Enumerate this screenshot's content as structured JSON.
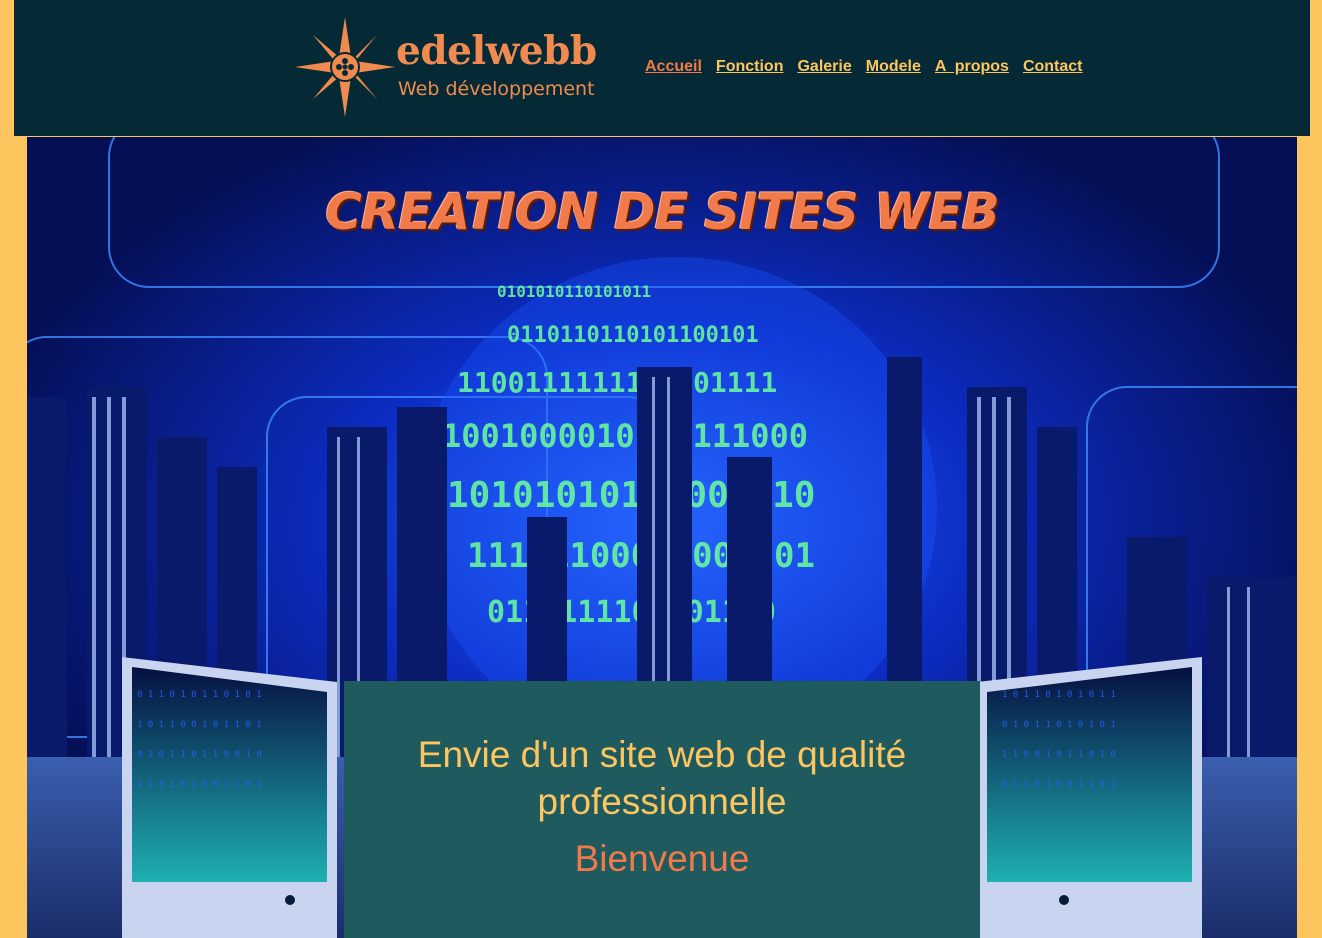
{
  "header": {
    "brand": "edelwebb",
    "tagline": "Web développement"
  },
  "nav": {
    "items": [
      {
        "label": "Accueil",
        "active": true
      },
      {
        "label": "Fonction",
        "active": false
      },
      {
        "label": "Galerie",
        "active": false
      },
      {
        "label": "Modele",
        "active": false
      },
      {
        "label": "A  propos",
        "active": false
      },
      {
        "label": "Contact",
        "active": false
      }
    ]
  },
  "hero": {
    "title": "CREATION DE SITES WEB"
  },
  "welcome": {
    "text": "Envie d'un site web de qualité professionnelle",
    "subtitle": "Bienvenue"
  },
  "colors": {
    "page_background": "#fdc55e",
    "header_background": "#062a35",
    "accent_orange": "#f07a4a",
    "accent_yellow": "#fdc55e",
    "panel_teal": "#1f5a5e"
  }
}
